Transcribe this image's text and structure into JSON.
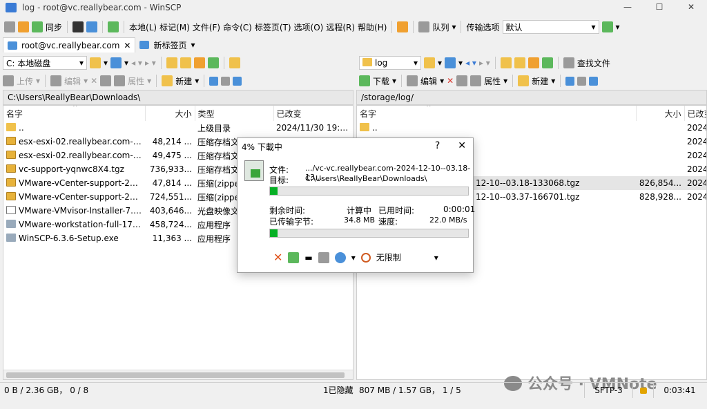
{
  "window": {
    "title": "log - root@vc.reallybear.com - WinSCP",
    "controls": [
      "—",
      "☐",
      "✕"
    ]
  },
  "toolbar": {
    "sync_label": "同步",
    "menus": [
      "本地(L)",
      "标记(M)",
      "文件(F)",
      "命令(C)",
      "标签页(T)",
      "选项(O)",
      "远程(R)",
      "帮助(H)"
    ],
    "queue_label": "队列",
    "transfer_options_label": "传输选项",
    "transfer_preset": "默认"
  },
  "tabs": [
    {
      "label": "root@vc.reallybear.com"
    },
    {
      "label": "新标签页"
    }
  ],
  "local": {
    "drive": "C: 本地磁盘",
    "actions": {
      "upload": "上传",
      "edit": "编辑",
      "properties": "属性",
      "new": "新建"
    },
    "path": "C:\\Users\\ReallyBear\\Downloads\\",
    "columns": {
      "name": "名字",
      "size": "大小",
      "type": "类型",
      "modified": "已改变"
    },
    "rows": [
      {
        "name": "..",
        "size": "",
        "type": "上级目录",
        "modified": "2024/11/30 19:39:43",
        "icon": "folder-up"
      },
      {
        "name": "esx-esxi-02.reallybear.com-202...",
        "size": "48,214 ...",
        "type": "压缩存档文件",
        "modified": "",
        "icon": "zip"
      },
      {
        "name": "esx-esxi-02.reallybear.com-202...",
        "size": "49,475 ...",
        "type": "压缩存档文件",
        "modified": "",
        "icon": "zip"
      },
      {
        "name": "vc-support-yqnwc8X4.tgz",
        "size": "736,933...",
        "type": "压缩存档文件",
        "modified": "",
        "icon": "zip"
      },
      {
        "name": "VMware-vCenter-support-2024...",
        "size": "47,814 ...",
        "type": "压缩(zipped)",
        "modified": "",
        "icon": "zip"
      },
      {
        "name": "VMware-vCenter-support-2024...",
        "size": "724,551...",
        "type": "压缩(zipped)",
        "modified": "",
        "icon": "zip"
      },
      {
        "name": "VMware-VMvisor-Installer-7.0....",
        "size": "403,646...",
        "type": "光盘映像文件",
        "modified": "",
        "icon": "iso"
      },
      {
        "name": "VMware-workstation-full-17.6.0...",
        "size": "458,724...",
        "type": "应用程序",
        "modified": "",
        "icon": "exe"
      },
      {
        "name": "WinSCP-6.3.6-Setup.exe",
        "size": "11,363 ...",
        "type": "应用程序",
        "modified": "",
        "icon": "exe"
      }
    ],
    "status": "0 B / 2.36 GB， 0 / 8",
    "hidden": "1已隐藏"
  },
  "remote": {
    "dir": "log",
    "actions": {
      "download": "下载",
      "edit": "编辑",
      "properties": "属性",
      "new": "新建",
      "find": "查找文件"
    },
    "path": "/storage/log/",
    "columns": {
      "name": "名字",
      "size": "大小",
      "modified": "已改变"
    },
    "rows": [
      {
        "name": "..",
        "size": "",
        "modified": "2024/"
      },
      {
        "name": "",
        "size": "",
        "modified": "2024/"
      },
      {
        "name": "",
        "size": "",
        "modified": "2024/"
      },
      {
        "name": "",
        "size": "",
        "modified": "2024/"
      },
      {
        "name": "12-10--03.18-133068.tgz",
        "size": "826,854...",
        "modified": "2024/"
      },
      {
        "name": "12-10--03.37-166701.tgz",
        "size": "828,928...",
        "modified": "2024/"
      }
    ],
    "status": "807 MB / 1.57 GB， 1 / 5"
  },
  "statusbar": {
    "protocol": "SFTP-3",
    "elapsed": "0:03:41"
  },
  "dialog": {
    "title": "4% 下載中",
    "help": "?",
    "close": "✕",
    "file_label": "文件:",
    "file_value": ".../vc-vc.reallybear.com-2024-12-10--03.18-13...",
    "target_label": "目标:",
    "target_value": "C:\\Users\\ReallyBear\\Downloads\\",
    "file_progress": 0.04,
    "remaining_label": "剩余时间:",
    "remaining_value": "计算中",
    "elapsed_label": "已用时间:",
    "elapsed_value": "0:00:01",
    "transferred_label": "已传输字节:",
    "transferred_value": "34.8 MB",
    "speed_label": "速度:",
    "speed_value": "22.0 MB/s",
    "total_progress": 0.04,
    "speed_limit": "无限制"
  },
  "watermark": "公众号 · VMNote"
}
